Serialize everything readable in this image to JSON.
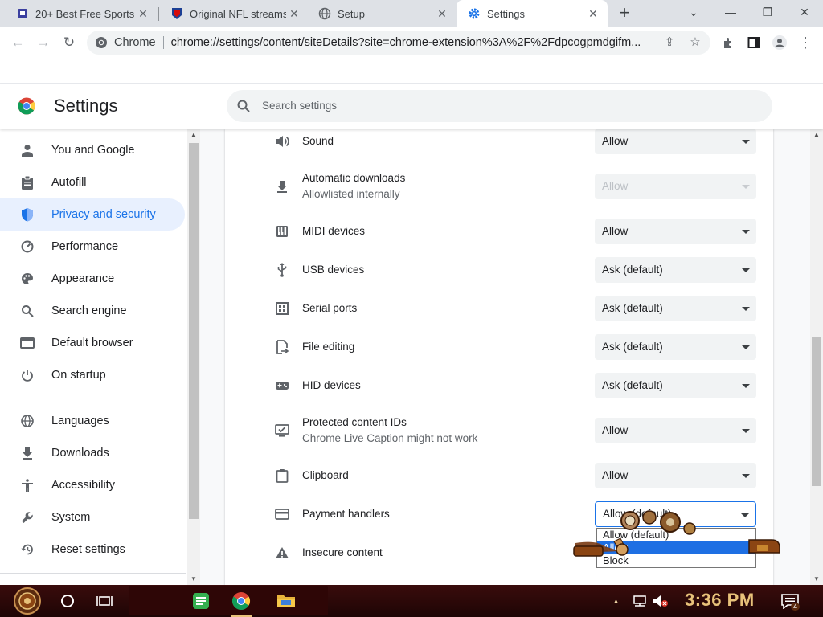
{
  "tabs": [
    {
      "title": "20+ Best Free Sports",
      "icon": "site-icon"
    },
    {
      "title": "Original NFL streams",
      "icon": "nfl-icon"
    },
    {
      "title": "Setup",
      "icon": "globe-icon"
    },
    {
      "title": "Settings",
      "icon": "gear-icon",
      "active": true
    }
  ],
  "window_controls": {
    "minimize": "—",
    "restore": "❐",
    "close": "✕",
    "tab_search": "⌄"
  },
  "omnibox": {
    "site_label": "Chrome",
    "url": "chrome://settings/content/siteDetails?site=chrome-extension%3A%2F%2Fdpcogpmdgifm..."
  },
  "header": {
    "title": "Settings",
    "search_placeholder": "Search settings"
  },
  "sidebar": {
    "items": [
      {
        "label": "You and Google",
        "icon": "person-icon"
      },
      {
        "label": "Autofill",
        "icon": "clipboard-icon"
      },
      {
        "label": "Privacy and security",
        "icon": "shield-icon",
        "active": true
      },
      {
        "label": "Performance",
        "icon": "speedometer-icon"
      },
      {
        "label": "Appearance",
        "icon": "palette-icon"
      },
      {
        "label": "Search engine",
        "icon": "search-icon"
      },
      {
        "label": "Default browser",
        "icon": "browser-icon"
      },
      {
        "label": "On startup",
        "icon": "power-icon"
      },
      {
        "label": "Languages",
        "icon": "globe-icon"
      },
      {
        "label": "Downloads",
        "icon": "download-icon"
      },
      {
        "label": "Accessibility",
        "icon": "accessibility-icon"
      },
      {
        "label": "System",
        "icon": "wrench-icon"
      },
      {
        "label": "Reset settings",
        "icon": "reset-icon"
      }
    ]
  },
  "permissions": [
    {
      "label": "Sound",
      "sublabel": "",
      "value": "Allow",
      "icon": "speaker-icon"
    },
    {
      "label": "Automatic downloads",
      "sublabel": "Allowlisted internally",
      "value": "Allow",
      "icon": "download-icon",
      "disabled": true
    },
    {
      "label": "MIDI devices",
      "sublabel": "",
      "value": "Allow",
      "icon": "piano-icon"
    },
    {
      "label": "USB devices",
      "sublabel": "",
      "value": "Ask (default)",
      "icon": "usb-icon"
    },
    {
      "label": "Serial ports",
      "sublabel": "",
      "value": "Ask (default)",
      "icon": "serial-port-icon"
    },
    {
      "label": "File editing",
      "sublabel": "",
      "value": "Ask (default)",
      "icon": "file-edit-icon"
    },
    {
      "label": "HID devices",
      "sublabel": "",
      "value": "Ask (default)",
      "icon": "gamepad-icon"
    },
    {
      "label": "Protected content IDs",
      "sublabel": "Chrome Live Caption might not work",
      "value": "Allow",
      "icon": "protected-content-icon"
    },
    {
      "label": "Clipboard",
      "sublabel": "",
      "value": "Allow",
      "icon": "clipboard-icon"
    },
    {
      "label": "Payment handlers",
      "sublabel": "",
      "value": "Allow (default)",
      "icon": "card-icon",
      "focused": true
    },
    {
      "label": "Insecure content",
      "sublabel": "",
      "value": "",
      "icon": "warning-icon"
    }
  ],
  "dropdown": {
    "options": [
      "Allow (default)",
      "Allow",
      "Block"
    ],
    "highlighted_index": 1
  },
  "taskbar": {
    "time": "3:36 PM",
    "notification_count": "4"
  },
  "colors": {
    "accent": "#1a73e8",
    "active_nav_bg": "#e8f0fe",
    "taskbar": "#2a0808",
    "clock": "#e8c27a"
  }
}
